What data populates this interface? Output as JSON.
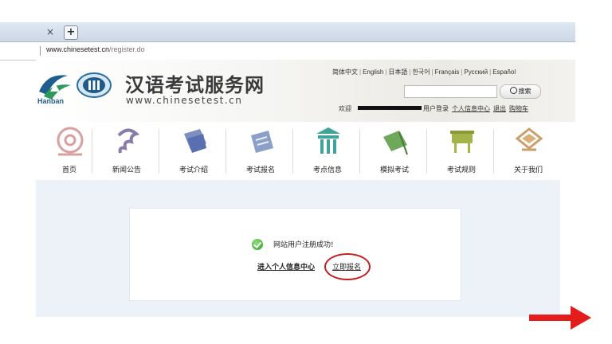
{
  "browser": {
    "tab_close": "×",
    "new_tab": "+",
    "url_host": "www.chinesetest.cn",
    "url_path": "/register.do"
  },
  "header": {
    "logo_text": "Hanban",
    "site_title": "汉语考试服务网",
    "site_url": "www.chinesetest.cn",
    "languages": [
      "简体中文",
      "English",
      "日本語",
      "한국어",
      "Français",
      "Русский",
      "Español"
    ],
    "search_placeholder": "",
    "search_button": "搜索",
    "welcome": "欢迎",
    "user_suffix": "用户登录",
    "links": [
      "个人信息中心",
      "退出",
      "购物车"
    ]
  },
  "nav": {
    "items": [
      {
        "label": "首页",
        "icon": "home-icon"
      },
      {
        "label": "新闻公告",
        "icon": "news-icon"
      },
      {
        "label": "考试介绍",
        "icon": "scroll-icon"
      },
      {
        "label": "考试报名",
        "icon": "register-icon"
      },
      {
        "label": "考点信息",
        "icon": "building-icon"
      },
      {
        "label": "模拟考试",
        "icon": "bamboo-icon"
      },
      {
        "label": "考试规则",
        "icon": "vessel-icon"
      },
      {
        "label": "关于我们",
        "icon": "about-icon"
      }
    ]
  },
  "main": {
    "success_message": "网站用户注册成功!",
    "personal_center_link": "进入个人信息中心",
    "register_now_link": "立即报名"
  },
  "colors": {
    "highlight_circle": "#c41e1e",
    "arrow": "#e41c1c",
    "content_bg": "#edf2f8"
  }
}
